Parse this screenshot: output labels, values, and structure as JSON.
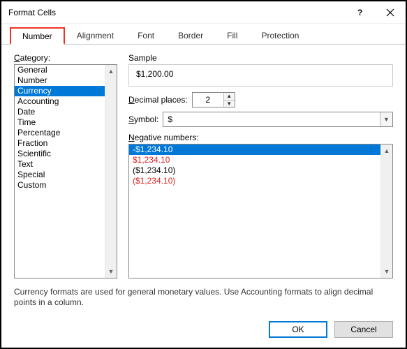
{
  "title": "Format Cells",
  "tabs": [
    {
      "label": "Number",
      "active": true
    },
    {
      "label": "Alignment",
      "active": false
    },
    {
      "label": "Font",
      "active": false
    },
    {
      "label": "Border",
      "active": false
    },
    {
      "label": "Fill",
      "active": false
    },
    {
      "label": "Protection",
      "active": false
    }
  ],
  "category_label": "Category:",
  "categories": [
    "General",
    "Number",
    "Currency",
    "Accounting",
    "Date",
    "Time",
    "Percentage",
    "Fraction",
    "Scientific",
    "Text",
    "Special",
    "Custom"
  ],
  "category_selected_index": 2,
  "sample_label": "Sample",
  "sample_value": "$1,200.00",
  "decimal_label": "Decimal places:",
  "decimal_value": "2",
  "symbol_label": "Symbol:",
  "symbol_value": "$",
  "negative_label": "Negative numbers:",
  "negative_numbers": [
    {
      "text": "-$1,234.10",
      "red": false,
      "selected": true
    },
    {
      "text": "$1,234.10",
      "red": true,
      "selected": false
    },
    {
      "text": "($1,234.10)",
      "red": false,
      "selected": false
    },
    {
      "text": "($1,234.10)",
      "red": true,
      "selected": false
    }
  ],
  "description": "Currency formats are used for general monetary values.  Use Accounting formats to align decimal points in a column.",
  "ok_label": "OK",
  "cancel_label": "Cancel"
}
